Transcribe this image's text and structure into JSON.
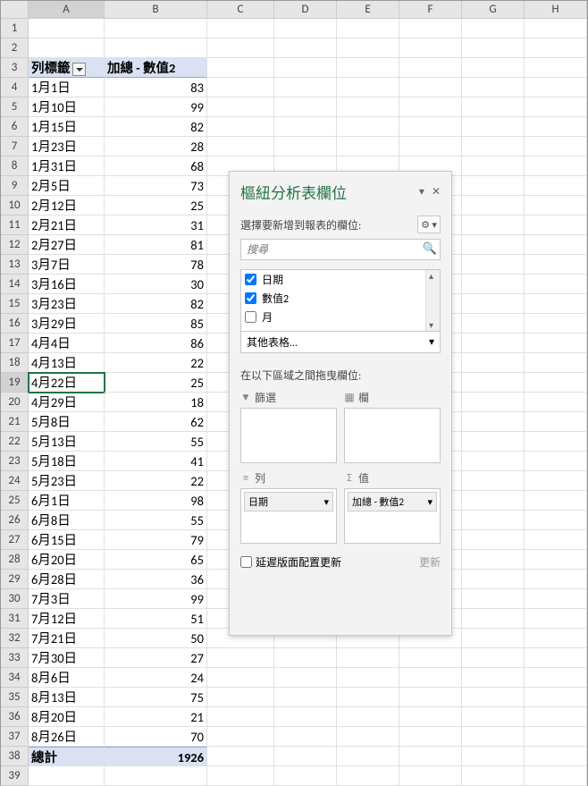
{
  "columns": [
    "A",
    "B",
    "C",
    "D",
    "E",
    "F",
    "G",
    "H"
  ],
  "header_row": 3,
  "headers": {
    "a": "列標籤",
    "b": "加總 - 數值2"
  },
  "rows": [
    {
      "n": 4,
      "a": "1月1日",
      "b": 83
    },
    {
      "n": 5,
      "a": "1月10日",
      "b": 99
    },
    {
      "n": 6,
      "a": "1月15日",
      "b": 82
    },
    {
      "n": 7,
      "a": "1月23日",
      "b": 28
    },
    {
      "n": 8,
      "a": "1月31日",
      "b": 68
    },
    {
      "n": 9,
      "a": "2月5日",
      "b": 73
    },
    {
      "n": 10,
      "a": "2月12日",
      "b": 25
    },
    {
      "n": 11,
      "a": "2月21日",
      "b": 31
    },
    {
      "n": 12,
      "a": "2月27日",
      "b": 81
    },
    {
      "n": 13,
      "a": "3月7日",
      "b": 78
    },
    {
      "n": 14,
      "a": "3月16日",
      "b": 30
    },
    {
      "n": 15,
      "a": "3月23日",
      "b": 82
    },
    {
      "n": 16,
      "a": "3月29日",
      "b": 85
    },
    {
      "n": 17,
      "a": "4月4日",
      "b": 86
    },
    {
      "n": 18,
      "a": "4月13日",
      "b": 22
    },
    {
      "n": 19,
      "a": "4月22日",
      "b": 25
    },
    {
      "n": 20,
      "a": "4月29日",
      "b": 18
    },
    {
      "n": 21,
      "a": "5月8日",
      "b": 62
    },
    {
      "n": 22,
      "a": "5月13日",
      "b": 55
    },
    {
      "n": 23,
      "a": "5月18日",
      "b": 41
    },
    {
      "n": 24,
      "a": "5月23日",
      "b": 22
    },
    {
      "n": 25,
      "a": "6月1日",
      "b": 98
    },
    {
      "n": 26,
      "a": "6月8日",
      "b": 55
    },
    {
      "n": 27,
      "a": "6月15日",
      "b": 79
    },
    {
      "n": 28,
      "a": "6月20日",
      "b": 65
    },
    {
      "n": 29,
      "a": "6月28日",
      "b": 36
    },
    {
      "n": 30,
      "a": "7月3日",
      "b": 99
    },
    {
      "n": 31,
      "a": "7月12日",
      "b": 51
    },
    {
      "n": 32,
      "a": "7月21日",
      "b": 50
    },
    {
      "n": 33,
      "a": "7月30日",
      "b": 27
    },
    {
      "n": 34,
      "a": "8月6日",
      "b": 24
    },
    {
      "n": 35,
      "a": "8月13日",
      "b": 75
    },
    {
      "n": 36,
      "a": "8月20日",
      "b": 21
    },
    {
      "n": 37,
      "a": "8月26日",
      "b": 70
    }
  ],
  "total": {
    "row": 38,
    "label": "總計",
    "value": 1926
  },
  "extra_rows": [
    39
  ],
  "selected": {
    "row": 19,
    "col": "A"
  },
  "pivot_panel": {
    "title": "樞紐分析表欄位",
    "choose_label": "選擇要新增到報表的欄位:",
    "search_placeholder": "搜尋",
    "fields": [
      {
        "name": "日期",
        "checked": true
      },
      {
        "name": "數值2",
        "checked": true
      },
      {
        "name": "月",
        "checked": false
      }
    ],
    "other_tables": "其他表格...",
    "drag_label": "在以下區域之間拖曳欄位:",
    "areas": {
      "filter": {
        "label": "篩選",
        "items": []
      },
      "columns": {
        "label": "欄",
        "items": []
      },
      "rows": {
        "label": "列",
        "items": [
          "日期"
        ]
      },
      "values": {
        "label": "值",
        "items": [
          "加總 - 數值2"
        ]
      }
    },
    "defer_label": "延遲版面配置更新",
    "update_label": "更新"
  }
}
